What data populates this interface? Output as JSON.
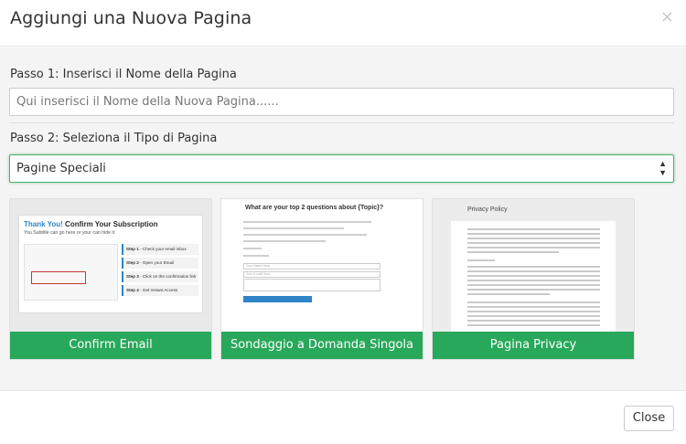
{
  "modal": {
    "title": "Aggiungi una Nuova Pagina",
    "close_icon": "×"
  },
  "step1": {
    "label": "Passo 1: Inserisci il Nome della Pagina",
    "placeholder": "Qui inserisci il Nome della Nuova Pagina......",
    "value": ""
  },
  "step2": {
    "label": "Passo 2: Seleziona il Tipo di Pagina",
    "selected": "Pagine Speciali",
    "arrow_up": "▲",
    "arrow_down": "▼"
  },
  "cards": [
    {
      "label": "Confirm Email",
      "preview": {
        "title_part1": "Thank You!",
        "title_part2": " Confirm Your Subscription",
        "subtitle": "You Subtitle can go here or your can hide it",
        "steps": [
          {
            "num": "Step 1",
            "text": " - Check your email inbox"
          },
          {
            "num": "Step 2",
            "text": " - Open your Email"
          },
          {
            "num": "Step 3",
            "text": " - Click on the confirmation link"
          },
          {
            "num": "Step 4",
            "text": " - Get Instant Access"
          }
        ]
      }
    },
    {
      "label": "Sondaggio a Domanda Singola",
      "preview": {
        "title": "What are your top 2 questions about {Topic}?",
        "field1": "Your Name Here...",
        "field2": "Your E-mail Here...",
        "area": "Enter Your Question Here..."
      }
    },
    {
      "label": "Pagina Privacy",
      "preview": {
        "title": "Privacy Policy"
      }
    }
  ],
  "footer": {
    "close_label": "Close"
  },
  "colors": {
    "accent_green": "#28a85a",
    "select_focus": "#4cae6c"
  },
  "icons": [
    "close-icon",
    "select-arrows-icon"
  ]
}
